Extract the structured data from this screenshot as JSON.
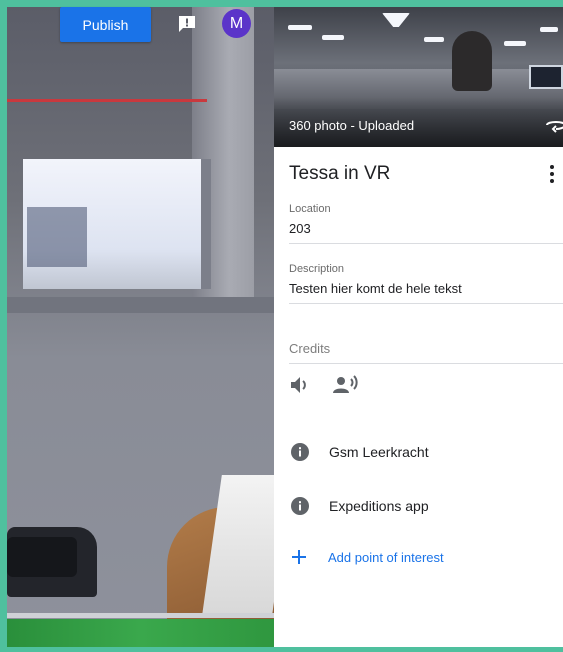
{
  "toolbar": {
    "publish_label": "Publish",
    "avatar_initial": "M"
  },
  "photo": {
    "caption": "360 photo - Uploaded"
  },
  "details": {
    "title": "Tessa in VR",
    "location_label": "Location",
    "location_value": "203",
    "description_label": "Description",
    "description_value": "Testen hier komt de hele tekst",
    "credits_placeholder": "Credits"
  },
  "points_of_interest": [
    {
      "label": "Gsm Leerkracht",
      "icon": "info-icon"
    },
    {
      "label": "Expeditions app",
      "icon": "info-icon"
    }
  ],
  "add_poi_label": "Add point of interest",
  "colors": {
    "frame": "#4fc09e",
    "primary": "#1a73e8",
    "avatar": "#5b34c9",
    "icon_gray": "#5f6368"
  }
}
